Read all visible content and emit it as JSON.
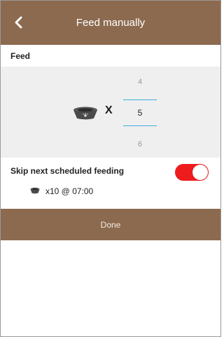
{
  "header": {
    "title": "Feed manually",
    "back_icon": "chevron-left-icon",
    "color": "#8c6a4f"
  },
  "feed_section": {
    "label": "Feed"
  },
  "portion_picker": {
    "bowl_icon": "food-bowl-icon",
    "multiply_sign": "X",
    "above": "4",
    "selected": "5",
    "below": "6",
    "accent_color": "#3bb0d9"
  },
  "skip_option": {
    "label": "Skip next scheduled feeding",
    "toggle_on": true,
    "toggle_color": "#ee1c1c",
    "schedule_icon": "food-bowl-icon",
    "schedule_text": "x10 @ 07:00"
  },
  "done_button": {
    "label": "Done"
  }
}
